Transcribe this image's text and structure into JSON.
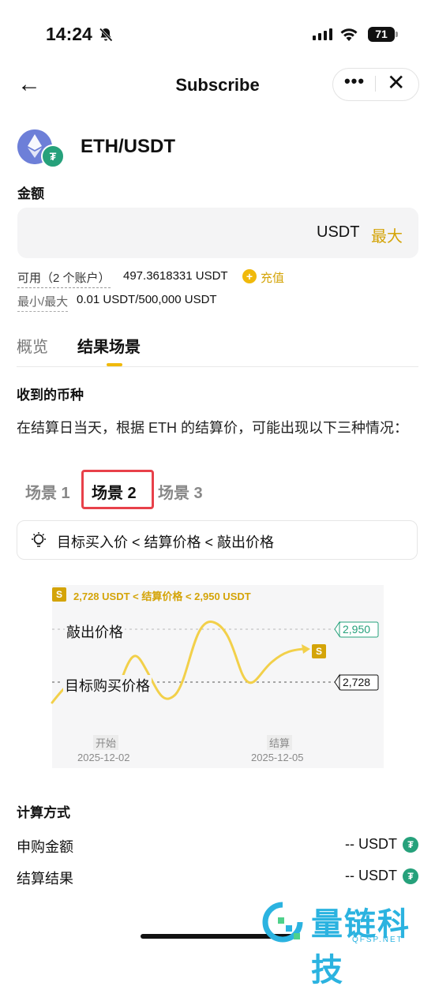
{
  "status_bar": {
    "time": "14:24",
    "battery": "71"
  },
  "header": {
    "title": "Subscribe",
    "more": "•••",
    "close": "✕",
    "back": "←"
  },
  "pair": {
    "name": "ETH/USDT",
    "badge": "₮"
  },
  "amount": {
    "label": "金额",
    "unit": "USDT",
    "max": "最大"
  },
  "availability": {
    "label": "可用（2 个账户）",
    "value": "497.3618331 USDT",
    "topup": "充值",
    "topup_icon": "+",
    "minmax_label": "最小/最大",
    "minmax_value": "0.01 USDT/500,000 USDT"
  },
  "tabs": [
    {
      "label": "概览",
      "active": false
    },
    {
      "label": "结果场景",
      "active": true
    }
  ],
  "receive": {
    "title": "收到的币种",
    "description": "在结算日当天，根据 ETH 的结算价，可能出现以下三种情况："
  },
  "scenarios": {
    "tabs": [
      "场景 1",
      "场景 2",
      "场景 3"
    ],
    "selected": 1,
    "condition": "目标买入价 < 结算价格 < 敲出价格"
  },
  "chart_data": {
    "type": "line",
    "range_label": "2,728 USDT < 结算价格 < 2,950 USDT",
    "badge": "S",
    "knock_out": {
      "label": "敲出价格",
      "value": "2,950"
    },
    "target": {
      "label": "目标购买价格",
      "value": "2,728"
    },
    "start": {
      "label": "开始",
      "date": "2025-12-02"
    },
    "settle": {
      "label": "结算",
      "date": "2025-12-05"
    },
    "accent": "#d4a408",
    "knock_color": "#26a17b"
  },
  "calc": {
    "title": "计算方式",
    "rows": [
      {
        "label": "申购金额",
        "value": "-- USDT"
      },
      {
        "label": "结算结果",
        "value": "-- USDT"
      }
    ],
    "icon": "₮"
  },
  "watermark": {
    "text": "量链科技",
    "sub": "QFSP.NET"
  }
}
